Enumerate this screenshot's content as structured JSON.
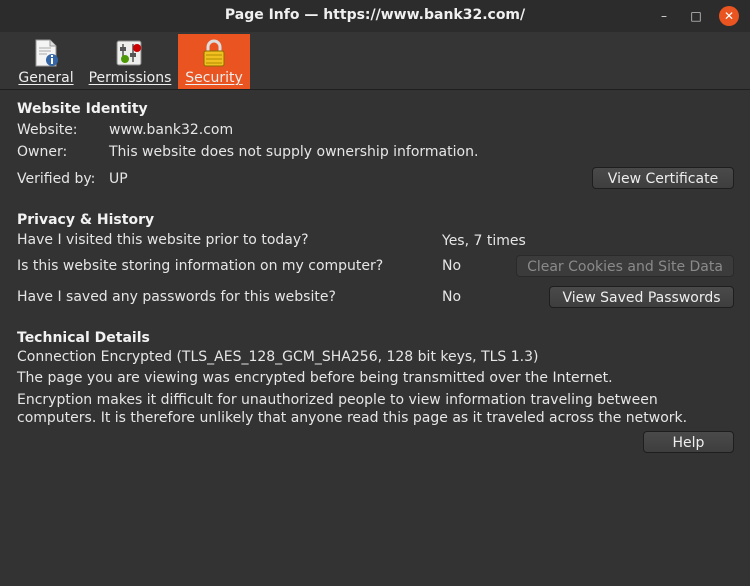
{
  "window": {
    "title": "Page Info — https://www.bank32.com/",
    "min_glyph": "–",
    "max_glyph": "□",
    "close_glyph": "✕"
  },
  "tabs": [
    {
      "label": "General",
      "icon": "document-info-icon"
    },
    {
      "label": "Permissions",
      "icon": "permissions-icon"
    },
    {
      "label": "Security",
      "icon": "padlock-icon",
      "active": true
    }
  ],
  "identity": {
    "heading": "Website Identity",
    "website_label": "Website:",
    "website_value": "www.bank32.com",
    "owner_label": "Owner:",
    "owner_value": "This website does not supply ownership information.",
    "verified_label": "Verified by:",
    "verified_value": "UP",
    "view_cert_button": "View Certificate"
  },
  "privacy": {
    "heading": "Privacy & History",
    "q1": "Have I visited this website prior to today?",
    "a1": "Yes, 7 times",
    "q2": "Is this website storing information on my computer?",
    "a2": "No",
    "clear_button": "Clear Cookies and Site Data",
    "q3": "Have I saved any passwords for this website?",
    "a3": "No",
    "view_passwords_button": "View Saved Passwords"
  },
  "technical": {
    "heading": "Technical Details",
    "line1": "Connection Encrypted (TLS_AES_128_GCM_SHA256, 128 bit keys, TLS 1.3)",
    "line2": "The page you are viewing was encrypted before being transmitted over the Internet.",
    "line3": "Encryption makes it difficult for unauthorized people to view information traveling between computers. It is therefore unlikely that anyone read this page as it traveled across the network.",
    "help_button": "Help"
  },
  "colors": {
    "accent": "#e95420",
    "background": "#333333",
    "titlebar": "#2c2c2c"
  }
}
